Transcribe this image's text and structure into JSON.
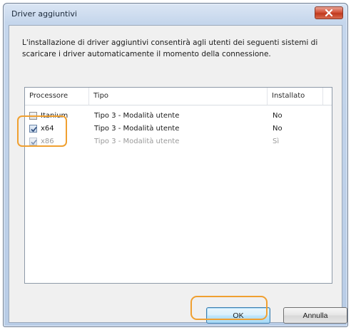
{
  "window": {
    "title": "Driver aggiuntivi",
    "close_icon": "close-icon"
  },
  "description": "L'installazione di driver aggiuntivi consentirà agli utenti dei seguenti sistemi di scaricare i driver automaticamente il momento della connessione.",
  "columns": {
    "processore": "Processore",
    "tipo": "Tipo",
    "installato": "Installato"
  },
  "rows": [
    {
      "processore": "Itanium",
      "tipo": "Tipo 3 - Modalità utente",
      "installato": "No",
      "checked": false,
      "disabled": false
    },
    {
      "processore": "x64",
      "tipo": "Tipo 3 - Modalità utente",
      "installato": "No",
      "checked": true,
      "disabled": false
    },
    {
      "processore": "x86",
      "tipo": "Tipo 3 - Modalità utente",
      "installato": "Sì",
      "checked": true,
      "disabled": true
    }
  ],
  "buttons": {
    "ok": "OK",
    "cancel": "Annulla"
  },
  "colors": {
    "highlight": "#f0a030",
    "close_button": "#c03a1e"
  }
}
